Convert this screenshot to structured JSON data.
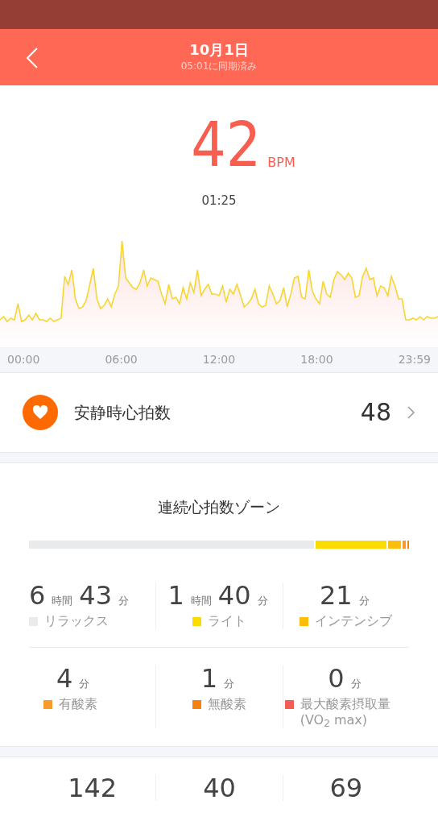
{
  "header": {
    "title": "10月1日",
    "subtitle": "05:01に同期済み"
  },
  "current": {
    "value": "42",
    "unit": "BPM",
    "time": "01:25"
  },
  "chart": {
    "x_labels": [
      "00:00",
      "06:00",
      "12:00",
      "18:00",
      "23:59"
    ]
  },
  "resting": {
    "label": "安静時心拍数",
    "value": "48"
  },
  "zones": {
    "title": "連続心拍数ゾーン",
    "items": [
      {
        "parts": [
          {
            "num": "6",
            "unit": "時間"
          },
          {
            "num": "43",
            "unit": "分"
          }
        ],
        "label": "リラックス",
        "color": "#e8eaec"
      },
      {
        "parts": [
          {
            "num": "1",
            "unit": "時間"
          },
          {
            "num": "40",
            "unit": "分"
          }
        ],
        "label": "ライト",
        "color": "#fadc00"
      },
      {
        "parts": [
          {
            "num": "21",
            "unit": "分"
          }
        ],
        "label": "インテンシブ",
        "color": "#fbbe0c"
      },
      {
        "parts": [
          {
            "num": "4",
            "unit": "分"
          }
        ],
        "label": "有酸素",
        "color": "#fb9a2c"
      },
      {
        "parts": [
          {
            "num": "1",
            "unit": "分"
          }
        ],
        "label": "無酸素",
        "color": "#f5820f"
      },
      {
        "parts": [
          {
            "num": "0",
            "unit": "分"
          }
        ],
        "label": "最大酸素摂取量 (VO$_{2}$ max)",
        "color": "#f45c56"
      }
    ]
  },
  "stats": [
    "142",
    "40",
    "69"
  ]
}
